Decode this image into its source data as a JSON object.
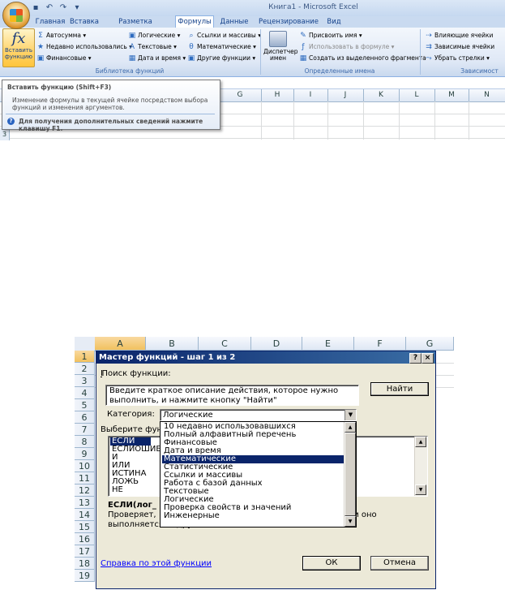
{
  "app": {
    "title": "Книга1 - Microsoft Excel"
  },
  "ribbon": {
    "tabs": [
      "Главная",
      "Вставка",
      "Разметка страницы",
      "Формулы",
      "Данные",
      "Рецензирование",
      "Вид"
    ],
    "active_tab": "Формулы",
    "insert_function": {
      "line1": "Вставить",
      "line2": "функцию"
    },
    "library": {
      "autosum": "Автосумма ▾",
      "recent": "Недавно использовались ▾",
      "financial": "Финансовые ▾",
      "logical": "Логические ▾",
      "text": "Текстовые ▾",
      "datetime": "Дата и время ▾",
      "lookup": "Ссылки и массивы ▾",
      "math": "Математические ▾",
      "other": "Другие функции ▾",
      "label": "Библиотека функций"
    },
    "names": {
      "manager_line1": "Диспетчер",
      "manager_line2": "имен",
      "assign": "Присвоить имя ▾",
      "use_in_formula": "Использовать в формуле ▾",
      "create_from_selection": "Создать из выделенного фрагмента",
      "label": "Определенные имена"
    },
    "audit": {
      "precedents": "Влияющие ячейки",
      "dependents": "Зависимые ячейки",
      "remove_arrows": "Убрать стрелки ▾",
      "label": "Зависимост"
    }
  },
  "tooltip": {
    "title": "Вставить функцию (Shift+F3)",
    "body": "Изменение формулы в текущей ячейке посредством выбора функций и изменения аргументов.",
    "help": "Для получения дополнительных сведений нажмите клавишу F1."
  },
  "top_grid": {
    "columns": [
      "G",
      "H",
      "I",
      "J",
      "K",
      "L",
      "M",
      "N"
    ],
    "rows": [
      "3"
    ]
  },
  "wizard_sheet": {
    "columns": [
      "A",
      "B",
      "C",
      "D",
      "E",
      "F",
      "G"
    ],
    "rows": [
      "1",
      "2",
      "3",
      "4",
      "5",
      "6",
      "7",
      "8",
      "9",
      "10",
      "11",
      "12",
      "13",
      "14",
      "15",
      "16",
      "17",
      "18",
      "19"
    ]
  },
  "dialog": {
    "title": "Мастер функций - шаг 1 из 2",
    "help_btn": "?",
    "close_btn": "×",
    "search_label": "Поиск функции:",
    "search_text": "Введите краткое описание действия, которое нужно выполнить, и нажмите кнопку \"Найти\"",
    "find_btn": "Найти",
    "category_label": "Категория:",
    "category_value": "Логические",
    "choose_label": "Выберите фун",
    "functions": [
      "ЕСЛИ",
      "ЕСЛИОШИБ",
      "И",
      "ИЛИ",
      "ИСТИНА",
      "ЛОЖЬ",
      "НЕ"
    ],
    "selected_function": "ЕСЛИ",
    "categories": [
      "10 недавно использовавшихся",
      "Полный алфавитный перечень",
      "Финансовые",
      "Дата и время",
      "Математические",
      "Статистические",
      "Ссылки и массивы",
      "Работа с базой данных",
      "Текстовые",
      "Логические",
      "Проверка свойств и значений",
      "Инженерные"
    ],
    "highlighted_category": "Математические",
    "syntax": "ЕСЛИ(лог_",
    "desc_part1": "Проверяет,",
    "desc_part2": "значение, если оно",
    "desc_line2": "выполняется, и другое значение, если нет.",
    "help_link": "Справка по этой функции",
    "ok_btn": "ОК",
    "cancel_btn": "Отмена"
  },
  "colors": {
    "ribbon_blue": "#15428b",
    "dialog_title": "#0a246a",
    "selection": "#0a246a",
    "cell_selected_header": "#f1c15f"
  }
}
